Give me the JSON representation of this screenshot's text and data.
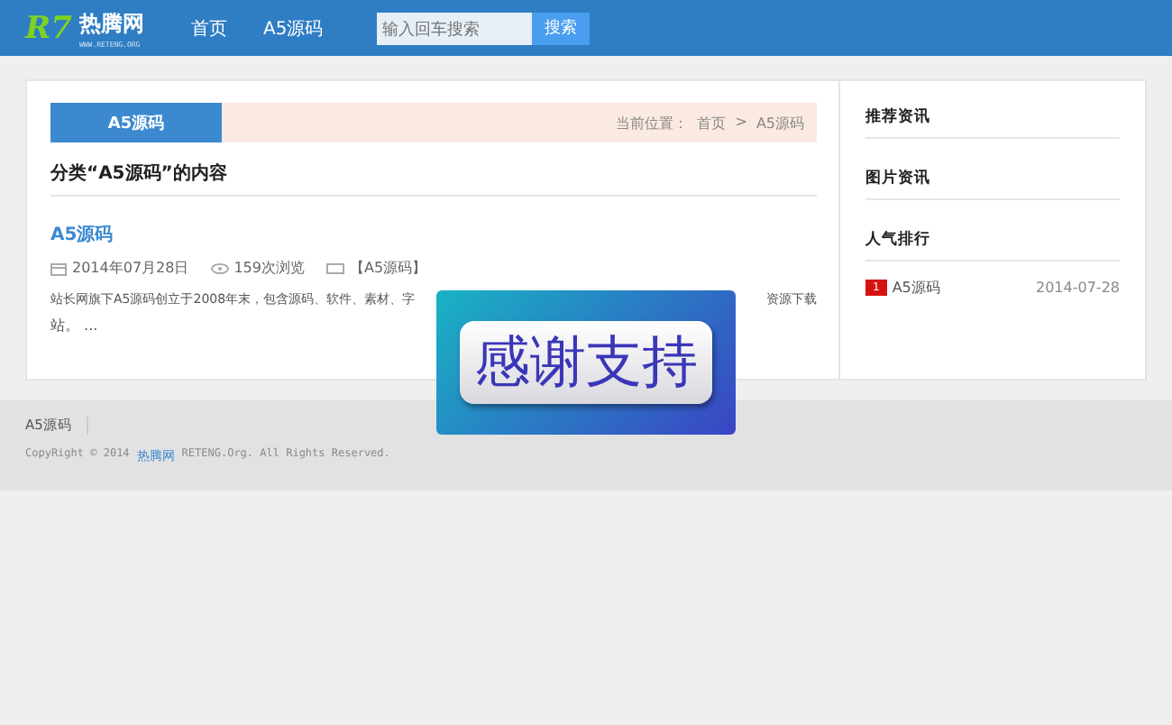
{
  "header": {
    "logo_mark": "R7",
    "logo_name": "热腾网",
    "logo_url": "WWW.RETENG.ORG",
    "nav": [
      {
        "label": "首页",
        "selected": false
      },
      {
        "label": "A5源码",
        "selected": false
      }
    ],
    "search": {
      "placeholder": "输入回车搜索",
      "button": "搜索"
    }
  },
  "main": {
    "category_tab": "A5源码",
    "breadcrumb": {
      "prefix": "当前位置：",
      "items": [
        "首页",
        "A5源码"
      ],
      "separator": ">"
    },
    "heading": "分类“A5源码”的内容",
    "post": {
      "title": "A5源码",
      "date": "2014年07月28日",
      "views": "159次浏览",
      "category": "【A5源码】",
      "excerpt_line1_start": "站长网旗下A5源码创立于2008年末，包含源码、软件、素材、字",
      "excerpt_line1_end": "资源下载",
      "excerpt_line2": "站。 ..."
    }
  },
  "sidebar": {
    "sections": [
      {
        "title": "推荐资讯"
      },
      {
        "title": "图片资讯"
      },
      {
        "title": "人气排行"
      }
    ],
    "ranking": [
      {
        "rank": "1",
        "title": "A5源码",
        "date": "2014-07-28"
      }
    ]
  },
  "footer": {
    "links": [
      "A5源码"
    ],
    "copyright_start": "CopyRight © 2014",
    "copyright_site": "热腾网",
    "copyright_end": "RETENG.Org. All Rights Reserved."
  },
  "overlay": {
    "text": "感谢支持"
  }
}
